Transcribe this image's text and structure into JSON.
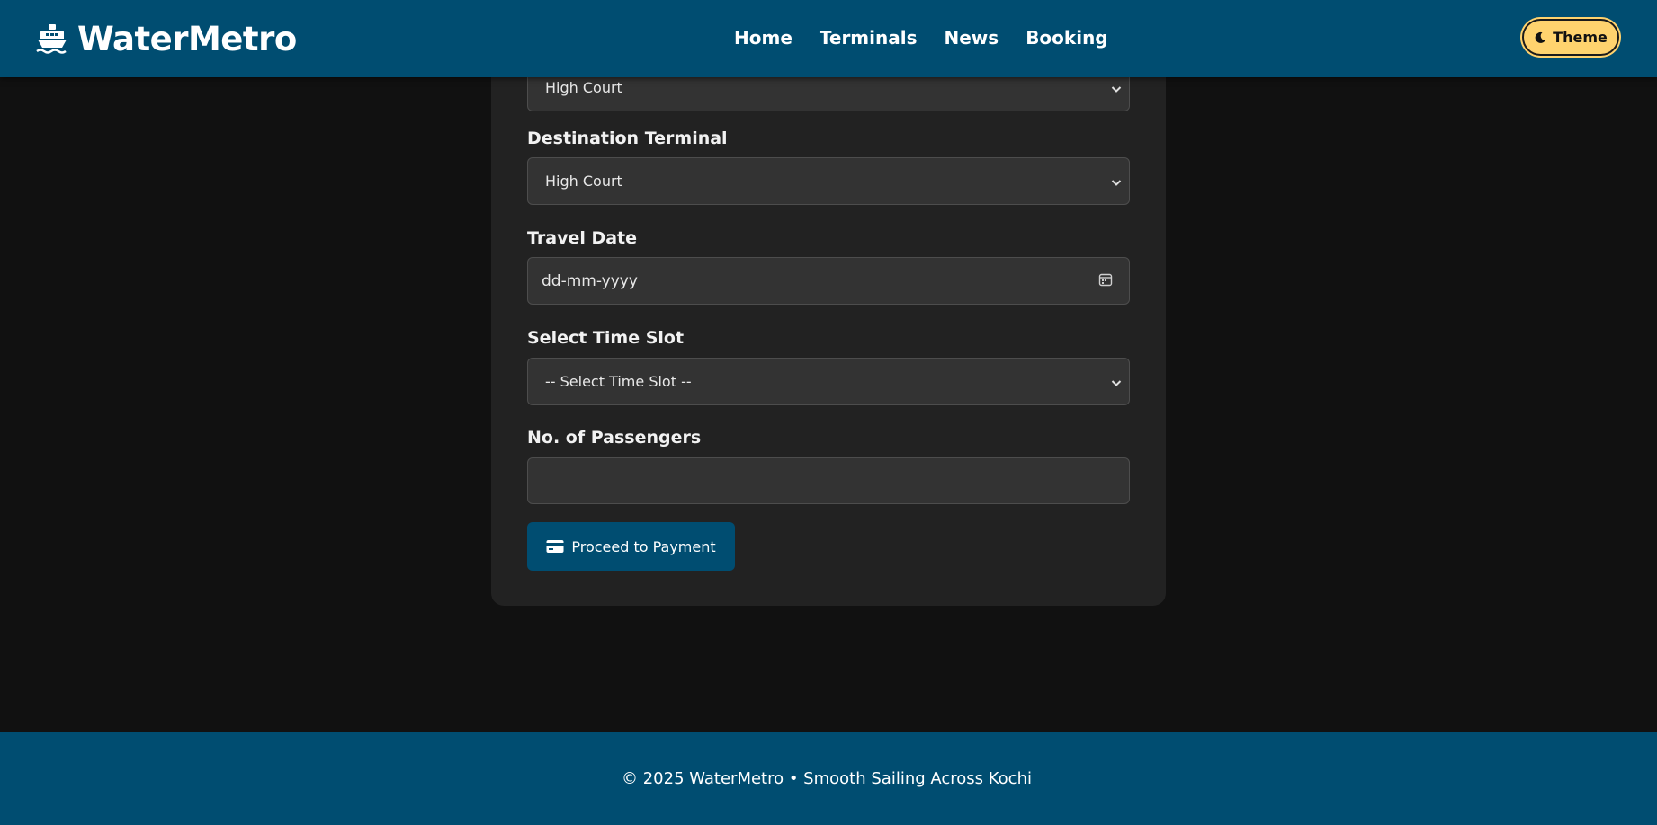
{
  "brand": {
    "name": "WaterMetro",
    "icon": "ship-icon"
  },
  "nav": {
    "items": [
      {
        "label": "Home"
      },
      {
        "label": "Terminals"
      },
      {
        "label": "News"
      },
      {
        "label": "Booking"
      }
    ]
  },
  "theme_toggle": {
    "label": "Theme",
    "icon": "moon-icon",
    "color": "#ffd36e"
  },
  "form": {
    "source_select": {
      "value": "High Court"
    },
    "destination": {
      "label": "Destination Terminal",
      "value": "High Court"
    },
    "travel_date": {
      "label": "Travel Date",
      "placeholder": "dd-mm-yyyy"
    },
    "time_slot": {
      "label": "Select Time Slot",
      "value": "-- Select Time Slot --"
    },
    "passengers": {
      "label": "No. of Passengers",
      "value": ""
    },
    "submit": {
      "label": "Proceed to Payment",
      "icon": "credit-card-icon"
    }
  },
  "footer": {
    "text": "© 2025 WaterMetro • Smooth Sailing Across Kochi"
  },
  "colors": {
    "primary": "#004d71",
    "background": "#111111",
    "card": "#222222",
    "input": "#333333"
  }
}
